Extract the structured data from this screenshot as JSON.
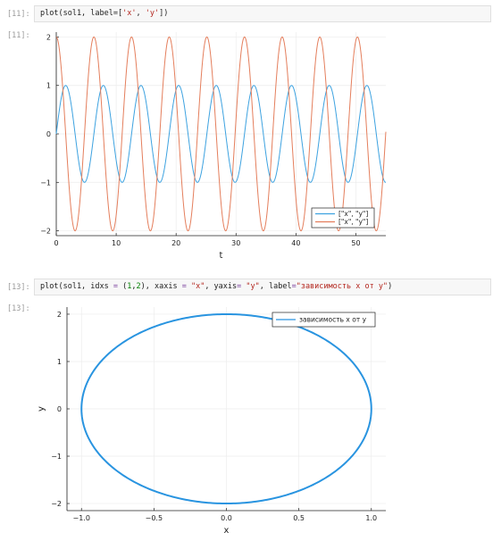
{
  "cells": [
    {
      "in_prompt": "[11]:",
      "out_prompt": "[11]:",
      "code_tokens": [
        {
          "t": "plot(sol1, label=[",
          "c": ""
        },
        {
          "t": "'x'",
          "c": "str"
        },
        {
          "t": ", ",
          "c": ""
        },
        {
          "t": "'y'",
          "c": "str"
        },
        {
          "t": "])",
          "c": ""
        }
      ]
    },
    {
      "in_prompt": "[13]:",
      "out_prompt": "[13]:",
      "code_tokens": [
        {
          "t": "plot(sol1, idxs ",
          "c": ""
        },
        {
          "t": "=",
          "c": "op"
        },
        {
          "t": " (",
          "c": ""
        },
        {
          "t": "1",
          "c": "num"
        },
        {
          "t": ",",
          "c": ""
        },
        {
          "t": "2",
          "c": "num"
        },
        {
          "t": "), xaxis ",
          "c": ""
        },
        {
          "t": "=",
          "c": "op"
        },
        {
          "t": " ",
          "c": ""
        },
        {
          "t": "\"x\"",
          "c": "str"
        },
        {
          "t": ", yaxis",
          "c": ""
        },
        {
          "t": "=",
          "c": "op"
        },
        {
          "t": " ",
          "c": ""
        },
        {
          "t": "\"y\"",
          "c": "str"
        },
        {
          "t": ", label",
          "c": ""
        },
        {
          "t": "=",
          "c": "op"
        },
        {
          "t": "\"зависимость x от y\"",
          "c": "str"
        },
        {
          "t": ")",
          "c": ""
        }
      ]
    }
  ],
  "chart_data": [
    {
      "type": "line",
      "xlabel": "t",
      "ylabel": "",
      "xlim": [
        0,
        55
      ],
      "ylim": [
        -2.1,
        2.1
      ],
      "xticks": [
        0,
        10,
        20,
        30,
        40,
        50
      ],
      "yticks": [
        -2,
        -1,
        0,
        1,
        2
      ],
      "grid": true,
      "legend_position": "bottom-right",
      "series": [
        {
          "name": "[\"x\", \"y\"]",
          "color": "#3da2e0",
          "amplitude": 1,
          "phase_shift": 0,
          "frequency": 1.0
        },
        {
          "name": "[\"x\", \"y\"]",
          "color": "#e47e5c",
          "amplitude": 2,
          "phase_shift": 1.5708,
          "frequency": 1.0
        }
      ]
    },
    {
      "type": "line",
      "xlabel": "x",
      "ylabel": "y",
      "xlim": [
        -1.1,
        1.1
      ],
      "ylim": [
        -2.15,
        2.15
      ],
      "xticks": [
        -1.0,
        -0.5,
        0.0,
        0.5,
        1.0
      ],
      "yticks": [
        -2,
        -1,
        0,
        1,
        2
      ],
      "grid": true,
      "legend_position": "top-right",
      "series": [
        {
          "name": "зависимость x от y",
          "color": "#2994e0",
          "rx": 1,
          "ry": 2
        }
      ]
    }
  ]
}
